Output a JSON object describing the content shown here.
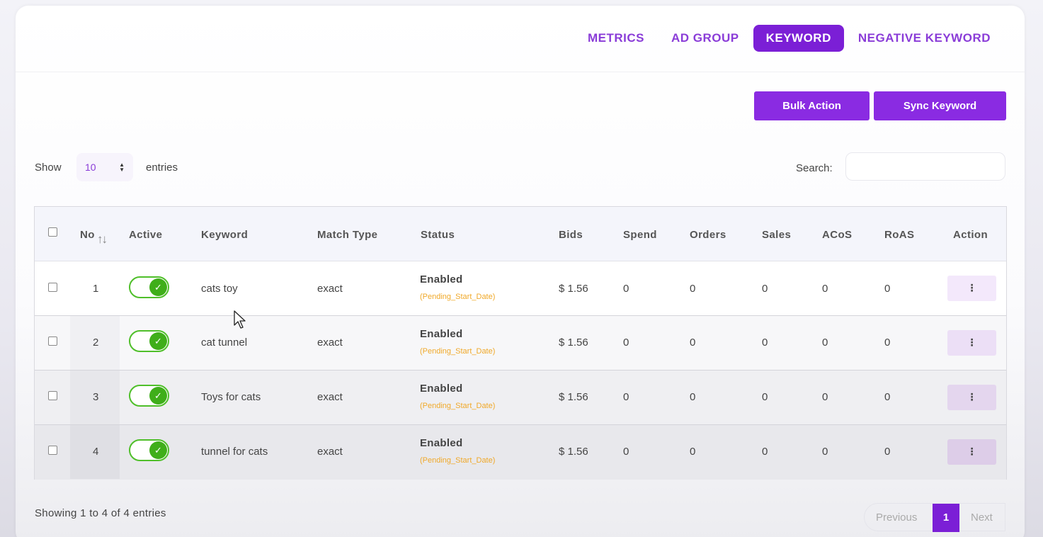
{
  "tabs": [
    {
      "label": "METRICS",
      "active": false
    },
    {
      "label": "AD GROUP",
      "active": false
    },
    {
      "label": "KEYWORD",
      "active": true
    },
    {
      "label": "NEGATIVE KEYWORD",
      "active": false
    }
  ],
  "toolbar": {
    "bulk_action": "Bulk Action",
    "sync_keyword": "Sync Keyword"
  },
  "length": {
    "show_label": "Show",
    "value": "10",
    "entries_label": "entries"
  },
  "search": {
    "label": "Search:",
    "value": "",
    "placeholder": ""
  },
  "table": {
    "headers": {
      "no": "No",
      "active": "Active",
      "keyword": "Keyword",
      "match_type": "Match Type",
      "status": "Status",
      "bids": "Bids",
      "spend": "Spend",
      "orders": "Orders",
      "sales": "Sales",
      "acos": "ACoS",
      "roas": "RoAS",
      "action": "Action"
    },
    "rows": [
      {
        "no": "1",
        "keyword": "cats toy",
        "match_type": "exact",
        "status": "Enabled",
        "status_note": "(Pending_Start_Date)",
        "bids": "$ 1.56",
        "spend": "0",
        "orders": "0",
        "sales": "0",
        "acos": "0",
        "roas": "0",
        "active": true
      },
      {
        "no": "2",
        "keyword": "cat tunnel",
        "match_type": "exact",
        "status": "Enabled",
        "status_note": "(Pending_Start_Date)",
        "bids": "$ 1.56",
        "spend": "0",
        "orders": "0",
        "sales": "0",
        "acos": "0",
        "roas": "0",
        "active": true
      },
      {
        "no": "3",
        "keyword": "Toys for cats",
        "match_type": "exact",
        "status": "Enabled",
        "status_note": "(Pending_Start_Date)",
        "bids": "$ 1.56",
        "spend": "0",
        "orders": "0",
        "sales": "0",
        "acos": "0",
        "roas": "0",
        "active": true
      },
      {
        "no": "4",
        "keyword": "tunnel for cats",
        "match_type": "exact",
        "status": "Enabled",
        "status_note": "(Pending_Start_Date)",
        "bids": "$ 1.56",
        "spend": "0",
        "orders": "0",
        "sales": "0",
        "acos": "0",
        "roas": "0",
        "active": true
      }
    ]
  },
  "footer": {
    "info": "Showing 1 to 4 of 4 entries",
    "previous": "Previous",
    "page": "1",
    "next": "Next"
  },
  "icons": {
    "sort": "sort-arrows-icon",
    "toggle_check": "check-icon",
    "row_menu": "vertical-ellipsis-icon",
    "select_caret": "updown-caret-icon",
    "cursor": "mouse-pointer-icon"
  },
  "colors": {
    "accent": "#8a2be2",
    "accent_dark": "#7b1fd6",
    "toggle_green": "#3fae1a",
    "pending_orange": "#f0a92a"
  }
}
